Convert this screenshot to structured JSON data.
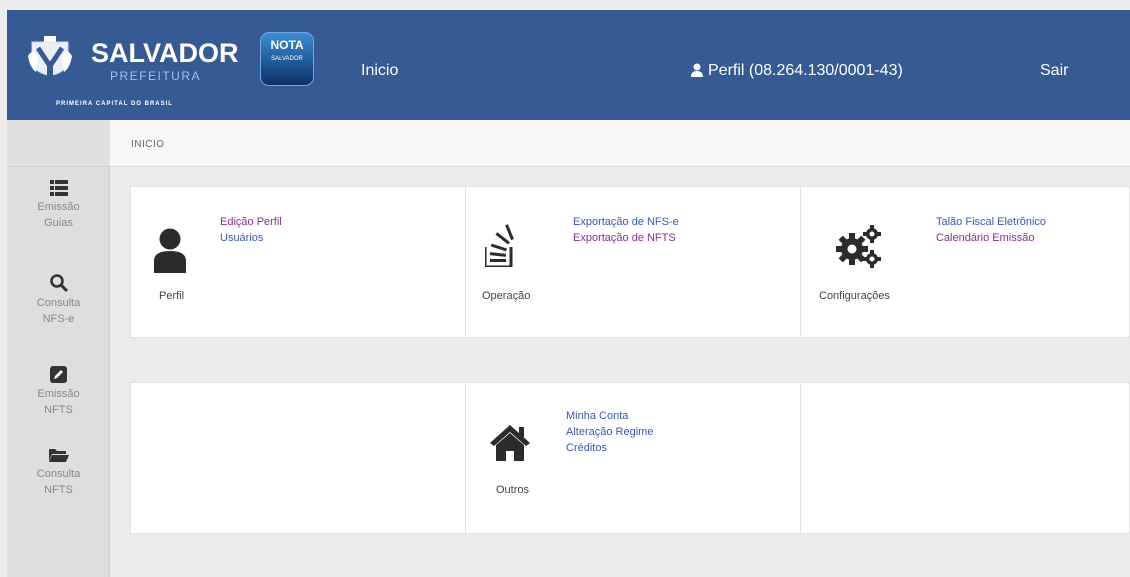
{
  "header": {
    "logo_title": "SALVADOR",
    "logo_subtitle": "PREFEITURA",
    "logo_tagline": "PRIMEIRA CAPITAL DO BRASIL",
    "badge_line1": "NOTA",
    "badge_line2": "SALVADOR",
    "nav_home": "Inicio",
    "nav_profile": "Perfil (08.264.130/0001-43)",
    "nav_logout": "Sair",
    "colors": {
      "bar": "#355a94",
      "text": "#ffffff"
    }
  },
  "breadcrumb": {
    "current": "INICIO"
  },
  "sidebar": {
    "items": [
      {
        "icon": "list-icon",
        "line1": "Emissão",
        "line2": "Guias"
      },
      {
        "icon": "search-icon",
        "line1": "Consulta",
        "line2": "NFS-e"
      },
      {
        "icon": "edit-icon",
        "line1": "Emissão",
        "line2": "NFTS"
      },
      {
        "icon": "folder-open-icon",
        "line1": "Consulta",
        "line2": "NFTS"
      }
    ]
  },
  "main": {
    "perfil": {
      "label": "Perfil",
      "icon": "user-icon",
      "links": [
        "Edição Perfil",
        "Usuários"
      ]
    },
    "operacao": {
      "label": "Operação",
      "icon": "stack-overflow-icon",
      "links": [
        "Exportação de NFS-e",
        "Exportação de NFTS"
      ]
    },
    "configuracoes": {
      "label": "Configurações",
      "icon": "gears-icon",
      "links": [
        "Talão Fiscal Eletrônico",
        "Calendário Emissão"
      ]
    },
    "outros": {
      "label": "Outros",
      "icon": "home-icon",
      "links": [
        "Minha Conta",
        "Alteração Regime",
        "Créditos"
      ]
    },
    "colors": {
      "link_purple": "#8a2f8f",
      "link_blue": "#3b57b8"
    }
  }
}
